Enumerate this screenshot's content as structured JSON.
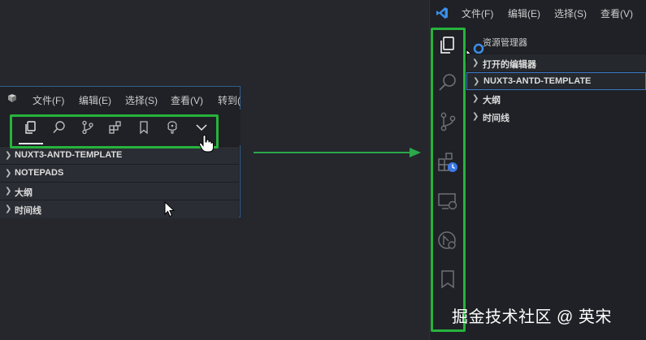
{
  "left_window": {
    "menu": [
      "文件(F)",
      "编辑(E)",
      "选择(S)",
      "查看(V)",
      "转到("
    ],
    "tabs": [
      {
        "name": "explorer-tab",
        "icon": "files-icon"
      },
      {
        "name": "search-tab",
        "icon": "search-icon"
      },
      {
        "name": "source-control-tab",
        "icon": "source-control-icon"
      },
      {
        "name": "extensions-tab",
        "icon": "extensions-icon"
      },
      {
        "name": "bookmarks-tab",
        "icon": "bookmark-icon"
      },
      {
        "name": "tree-tab",
        "icon": "tree-icon"
      },
      {
        "name": "more-tab",
        "icon": "chevron-down-icon"
      }
    ],
    "sections": [
      "NUXT3-ANTD-TEMPLATE",
      "NOTEPADS",
      "大纲",
      "时间线"
    ]
  },
  "right_window": {
    "menu": [
      "文件(F)",
      "编辑(E)",
      "选择(S)",
      "查看(V)"
    ],
    "explorer_title": "资源管理器",
    "sections": [
      "打开的编辑器",
      "NUXT3-ANTD-TEMPLATE",
      "大纲",
      "时间线"
    ],
    "activity_icons": [
      "files-icon",
      "search-icon",
      "source-control-icon",
      "extensions-clock-icon",
      "remote-explorer-icon",
      "git-graph-icon",
      "bookmark-icon"
    ]
  },
  "watermark": "掘金技术社区 @ 英宋",
  "colors": {
    "highlight": "#27b33c",
    "arrow": "#2aa84a",
    "vscode_blue": "#3b8eea"
  }
}
